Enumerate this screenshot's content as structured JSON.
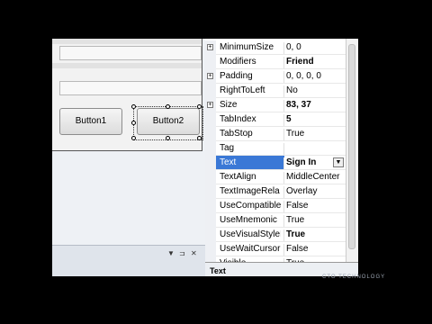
{
  "designer": {
    "button1_label": "Button1",
    "button2_label": "Button2"
  },
  "panel": {
    "dropdown_glyph": "▼",
    "pin_glyph": "⊐",
    "close_glyph": "✕"
  },
  "properties": [
    {
      "name": "MinimumSize",
      "value": "0, 0",
      "expandable": true,
      "bold": false
    },
    {
      "name": "Modifiers",
      "value": "Friend",
      "expandable": false,
      "bold": true
    },
    {
      "name": "Padding",
      "value": "0, 0, 0, 0",
      "expandable": true,
      "bold": false
    },
    {
      "name": "RightToLeft",
      "value": "No",
      "expandable": false,
      "bold": false
    },
    {
      "name": "Size",
      "value": "83, 37",
      "expandable": true,
      "bold": true
    },
    {
      "name": "TabIndex",
      "value": "5",
      "expandable": false,
      "bold": true
    },
    {
      "name": "TabStop",
      "value": "True",
      "expandable": false,
      "bold": false
    },
    {
      "name": "Tag",
      "value": "",
      "expandable": false,
      "bold": false
    },
    {
      "name": "Text",
      "value": "Sign In",
      "expandable": false,
      "bold": true,
      "selected": true
    },
    {
      "name": "TextAlign",
      "value": "MiddleCenter",
      "expandable": false,
      "bold": false
    },
    {
      "name": "TextImageRela",
      "value": "Overlay",
      "expandable": false,
      "bold": false
    },
    {
      "name": "UseCompatible",
      "value": "False",
      "expandable": false,
      "bold": false
    },
    {
      "name": "UseMnemonic",
      "value": "True",
      "expandable": false,
      "bold": false
    },
    {
      "name": "UseVisualStyleB",
      "value": "True",
      "expandable": false,
      "bold": true
    },
    {
      "name": "UseWaitCursor",
      "value": "False",
      "expandable": false,
      "bold": false
    },
    {
      "name": "Visible",
      "value": "True",
      "expandable": false,
      "bold": false
    }
  ],
  "description": {
    "title": "Text"
  },
  "dropdown_arrow": "▼",
  "watermark": "CTO TECHNOLOGY"
}
